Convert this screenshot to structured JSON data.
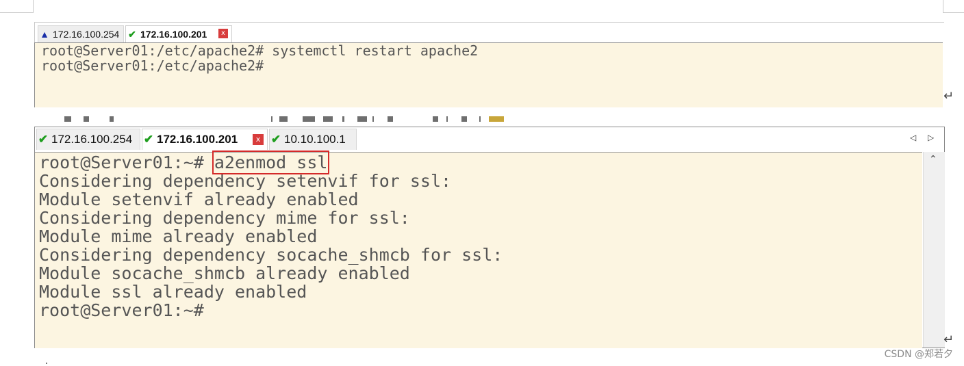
{
  "top_window": {
    "tabs": [
      {
        "label": "172.16.100.254",
        "status_icon": "warning-icon"
      },
      {
        "label": "172.16.100.201",
        "status_icon": "check-icon",
        "active": true
      }
    ],
    "close_glyph": "x",
    "terminal_lines": [
      "root@Server01:/etc/apache2# systemctl restart apache2",
      "root@Server01:/etc/apache2#"
    ]
  },
  "bottom_window": {
    "tabs": [
      {
        "label": "172.16.100.254",
        "status_icon": "check-icon"
      },
      {
        "label": "172.16.100.201",
        "status_icon": "check-icon",
        "active": true
      },
      {
        "label": "10.10.100.1",
        "status_icon": "check-icon"
      }
    ],
    "close_glyph": "x",
    "nav_prev": "◁",
    "nav_next": "▷",
    "scroll_up": "⌃",
    "prompt": "root@Server01:~# ",
    "command": "a2enmod ssl",
    "output_lines": [
      "Considering dependency setenvif for ssl:",
      "Module setenvif already enabled",
      "Considering dependency mime for ssl:",
      "Module mime already enabled",
      "Considering dependency socache_shmcb for ssl:",
      "Module socache_shmcb already enabled",
      "Module ssl already enabled",
      "root@Server01:~#"
    ]
  },
  "paragraph_mark": "↵",
  "watermark": "CSDN @郑若夕",
  "colors": {
    "terminal_bg": "#fcf5e1",
    "terminal_text": "#555555",
    "check": "#1f9e1f",
    "warning": "#1a2fa8",
    "close": "#d83c3c",
    "highlight_box": "#d42a2a"
  }
}
